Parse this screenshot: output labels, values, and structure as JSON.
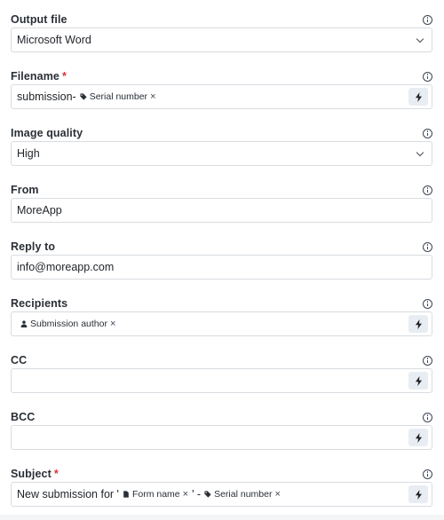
{
  "fields": {
    "output_file": {
      "label": "Output file",
      "value": "Microsoft Word"
    },
    "filename": {
      "label": "Filename",
      "required": "*",
      "prefix": "submission-",
      "chips": [
        "Serial number"
      ]
    },
    "image_quality": {
      "label": "Image quality",
      "value": "High"
    },
    "from": {
      "label": "From",
      "value": "MoreApp"
    },
    "reply_to": {
      "label": "Reply to",
      "value": "info@moreapp.com"
    },
    "recipients": {
      "label": "Recipients",
      "chips": [
        "Submission author"
      ]
    },
    "cc": {
      "label": "CC"
    },
    "bcc": {
      "label": "BCC"
    },
    "subject": {
      "label": "Subject",
      "required": "*",
      "prefix": "New submission for '",
      "middle": "' -",
      "chips": [
        "Form name",
        "Serial number"
      ]
    }
  },
  "icons": {
    "info": "info-icon",
    "dropdown": "chevron-down-icon",
    "insert": "bolt-icon",
    "tag": "tag-icon",
    "user": "user-icon",
    "document": "document-icon",
    "remove": "close-icon"
  },
  "colors": {
    "required": "#e0303a",
    "insert_button_bg": "#e8edf3",
    "border": "#d8dce1"
  }
}
